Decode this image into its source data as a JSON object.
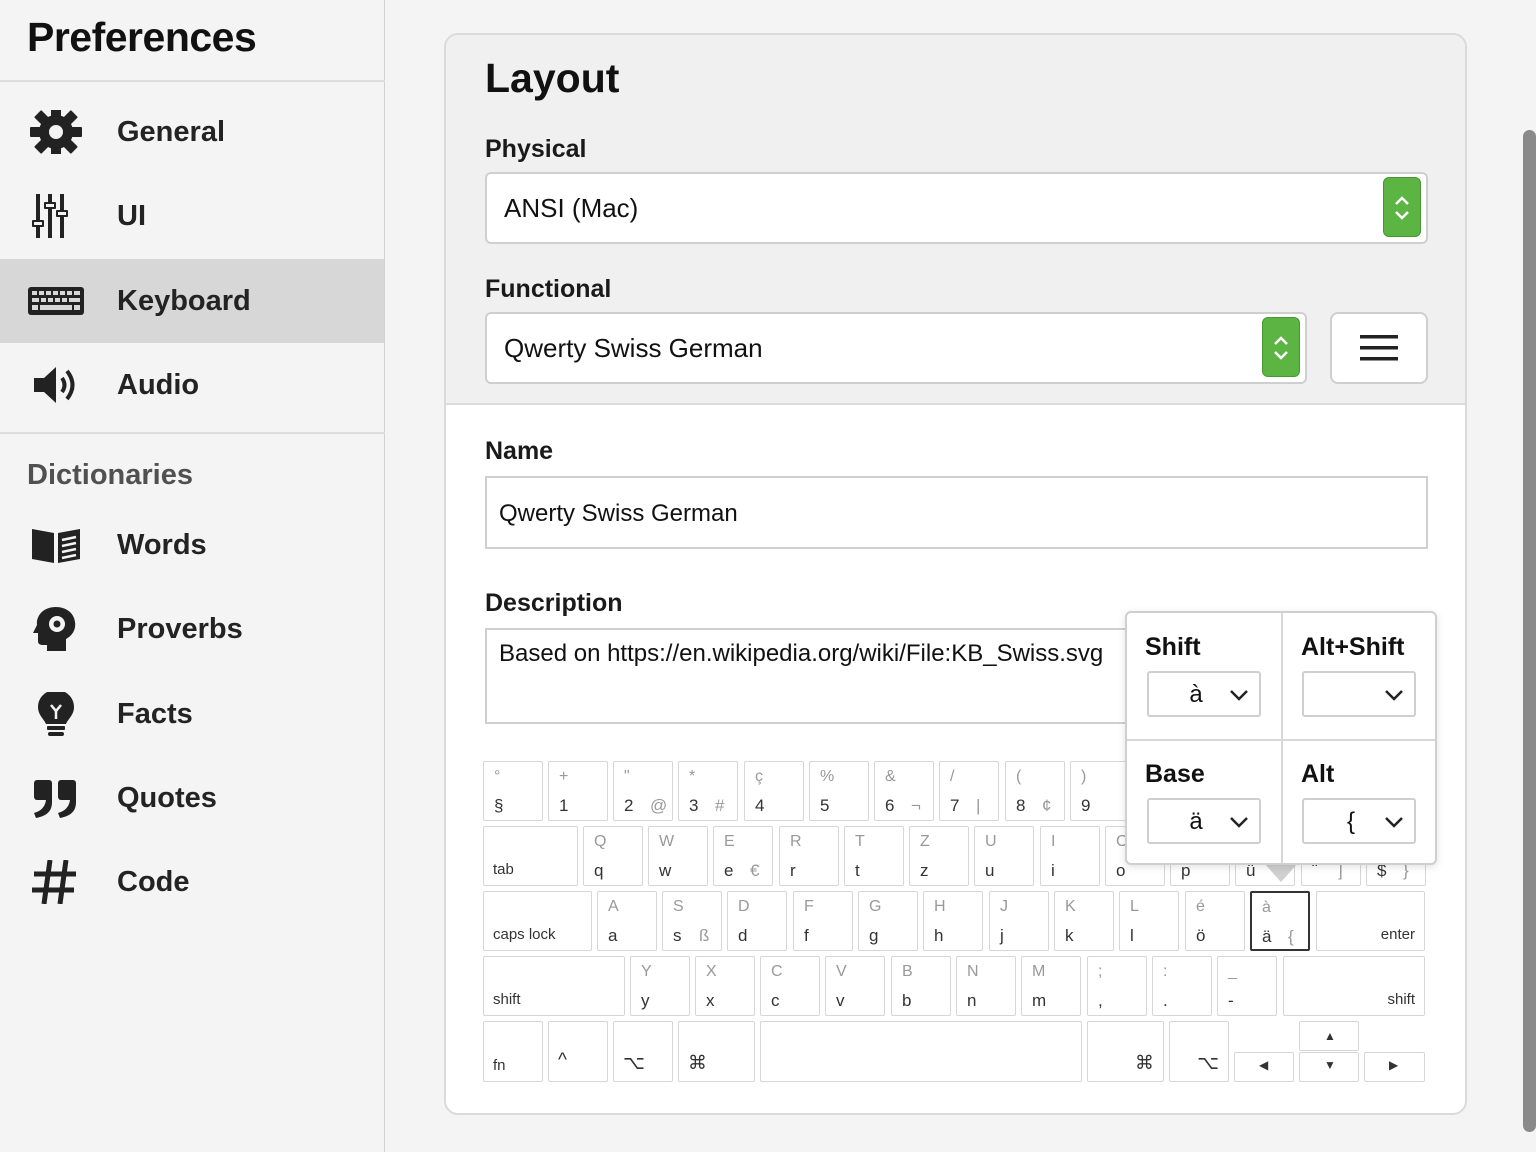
{
  "sidebar": {
    "title": "Preferences",
    "items": [
      {
        "label": "General",
        "icon": "gear-icon"
      },
      {
        "label": "UI",
        "icon": "sliders-icon"
      },
      {
        "label": "Keyboard",
        "icon": "keyboard-icon",
        "active": true
      },
      {
        "label": "Audio",
        "icon": "speaker-icon"
      }
    ],
    "section_label": "Dictionaries",
    "dict_items": [
      {
        "label": "Words",
        "icon": "book-icon"
      },
      {
        "label": "Proverbs",
        "icon": "head-gear-icon"
      },
      {
        "label": "Facts",
        "icon": "lightbulb-icon"
      },
      {
        "label": "Quotes",
        "icon": "quote-icon"
      },
      {
        "label": "Code",
        "icon": "hash-icon"
      }
    ]
  },
  "layout": {
    "title": "Layout",
    "physical_label": "Physical",
    "physical_value": "ANSI (Mac)",
    "functional_label": "Functional",
    "functional_value": "Qwerty Swiss German",
    "name_label": "Name",
    "name_value": "Qwerty Swiss German",
    "description_label": "Description",
    "description_value": "Based on https://en.wikipedia.org/wiki/File:KB_Swiss.svg"
  },
  "colors": {
    "accent": "#5cb443",
    "active_nav": "#d7d7d7"
  },
  "keyboard": {
    "row1": [
      {
        "top": "°",
        "base": "§",
        "alt": ""
      },
      {
        "top": "+",
        "base": "1",
        "alt": ""
      },
      {
        "top": "\"",
        "base": "2",
        "alt": "@"
      },
      {
        "top": "*",
        "base": "3",
        "alt": "#"
      },
      {
        "top": "ç",
        "base": "4",
        "alt": ""
      },
      {
        "top": "%",
        "base": "5",
        "alt": ""
      },
      {
        "top": "&",
        "base": "6",
        "alt": "¬"
      },
      {
        "top": "/",
        "base": "7",
        "alt": "|"
      },
      {
        "top": "(",
        "base": "8",
        "alt": "¢"
      },
      {
        "top": ")",
        "base": "9",
        "alt": ""
      }
    ],
    "row2_tab": "tab",
    "row2": [
      {
        "top": "Q",
        "base": "q",
        "alt": ""
      },
      {
        "top": "W",
        "base": "w",
        "alt": ""
      },
      {
        "top": "E",
        "base": "e",
        "alt": "€"
      },
      {
        "top": "R",
        "base": "r",
        "alt": ""
      },
      {
        "top": "T",
        "base": "t",
        "alt": ""
      },
      {
        "top": "Z",
        "base": "z",
        "alt": ""
      },
      {
        "top": "U",
        "base": "u",
        "alt": ""
      },
      {
        "top": "I",
        "base": "i",
        "alt": ""
      },
      {
        "top": "O",
        "base": "o",
        "alt": ""
      },
      {
        "top": "",
        "base": "p",
        "alt": ""
      },
      {
        "top": "",
        "base": "ü",
        "alt": ""
      },
      {
        "top": "!",
        "base": "¨",
        "alt": "]"
      },
      {
        "top": "",
        "base": "$",
        "alt": "}"
      }
    ],
    "row3_caps": "caps lock",
    "row3": [
      {
        "top": "A",
        "base": "a",
        "alt": ""
      },
      {
        "top": "S",
        "base": "s",
        "alt": "ß"
      },
      {
        "top": "D",
        "base": "d",
        "alt": ""
      },
      {
        "top": "F",
        "base": "f",
        "alt": ""
      },
      {
        "top": "G",
        "base": "g",
        "alt": ""
      },
      {
        "top": "H",
        "base": "h",
        "alt": ""
      },
      {
        "top": "J",
        "base": "j",
        "alt": ""
      },
      {
        "top": "K",
        "base": "k",
        "alt": ""
      },
      {
        "top": "L",
        "base": "l",
        "alt": ""
      },
      {
        "top": "é",
        "base": "ö",
        "alt": ""
      },
      {
        "top": "à",
        "base": "ä",
        "alt": "{",
        "selected": true
      }
    ],
    "row3_enter": "enter",
    "row4_shift_left": "shift",
    "row4": [
      {
        "top": "Y",
        "base": "y",
        "alt": ""
      },
      {
        "top": "X",
        "base": "x",
        "alt": ""
      },
      {
        "top": "C",
        "base": "c",
        "alt": ""
      },
      {
        "top": "V",
        "base": "v",
        "alt": ""
      },
      {
        "top": "B",
        "base": "b",
        "alt": ""
      },
      {
        "top": "N",
        "base": "n",
        "alt": ""
      },
      {
        "top": "M",
        "base": "m",
        "alt": ""
      },
      {
        "top": ";",
        "base": ",",
        "alt": ""
      },
      {
        "top": ":",
        "base": ".",
        "alt": ""
      },
      {
        "top": "_",
        "base": "-",
        "alt": ""
      }
    ],
    "row4_shift_right": "shift",
    "row5": {
      "fn": "fn",
      "ctrl": "^",
      "opt_left": "⌥",
      "cmd_left": "⌘",
      "cmd_right": "⌘",
      "opt_right": "⌥",
      "arrow_up": "▲",
      "arrow_down": "▼",
      "arrow_left": "◀",
      "arrow_right": "▶"
    }
  },
  "key_popover": {
    "shift_label": "Shift",
    "shift_value": "à",
    "alt_shift_label": "Alt+Shift",
    "alt_shift_value": "",
    "base_label": "Base",
    "base_value": "ä",
    "alt_label": "Alt",
    "alt_value": "{"
  }
}
